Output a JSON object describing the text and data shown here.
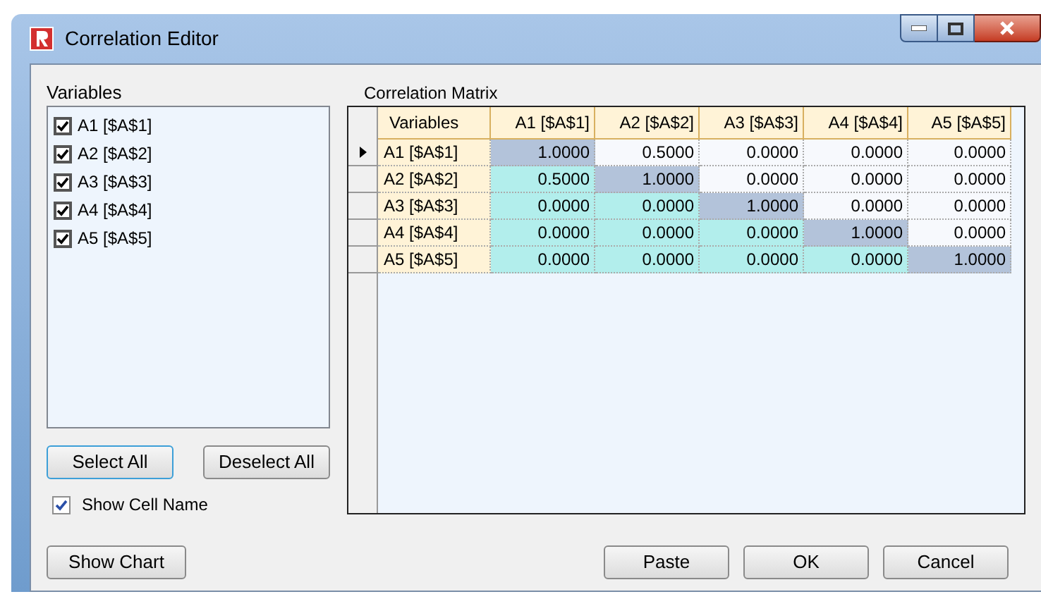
{
  "window": {
    "title": "Correlation Editor"
  },
  "variables": {
    "label": "Variables",
    "items": [
      {
        "label": "A1 [$A$1]",
        "checked": true
      },
      {
        "label": "A2 [$A$2]",
        "checked": true
      },
      {
        "label": "A3 [$A$3]",
        "checked": true
      },
      {
        "label": "A4 [$A$4]",
        "checked": true
      },
      {
        "label": "A5 [$A$5]",
        "checked": true
      }
    ]
  },
  "select_all": "Select All",
  "deselect_all": "Deselect All",
  "show_cell_name": {
    "label": "Show Cell Name",
    "checked": true
  },
  "matrix": {
    "label": "Correlation Matrix",
    "columns": [
      "Variables",
      "A1 [$A$1]",
      "A2 [$A$2]",
      "A3 [$A$3]",
      "A4 [$A$4]",
      "A5 [$A$5]"
    ],
    "rows": [
      {
        "current": true,
        "cells": [
          {
            "value": "A1 [$A$1]",
            "kind": "name"
          },
          {
            "value": "1.0000",
            "kind": "diagonal"
          },
          {
            "value": "0.5000",
            "kind": "upper"
          },
          {
            "value": "0.0000",
            "kind": "upper"
          },
          {
            "value": "0.0000",
            "kind": "upper"
          },
          {
            "value": "0.0000",
            "kind": "upper"
          }
        ]
      },
      {
        "current": false,
        "cells": [
          {
            "value": "A2 [$A$2]",
            "kind": "name"
          },
          {
            "value": "0.5000",
            "kind": "lower"
          },
          {
            "value": "1.0000",
            "kind": "diagonal"
          },
          {
            "value": "0.0000",
            "kind": "upper"
          },
          {
            "value": "0.0000",
            "kind": "upper"
          },
          {
            "value": "0.0000",
            "kind": "upper"
          }
        ]
      },
      {
        "current": false,
        "cells": [
          {
            "value": "A3 [$A$3]",
            "kind": "name"
          },
          {
            "value": "0.0000",
            "kind": "lower"
          },
          {
            "value": "0.0000",
            "kind": "lower"
          },
          {
            "value": "1.0000",
            "kind": "diagonal"
          },
          {
            "value": "0.0000",
            "kind": "upper"
          },
          {
            "value": "0.0000",
            "kind": "upper"
          }
        ]
      },
      {
        "current": false,
        "cells": [
          {
            "value": "A4 [$A$4]",
            "kind": "name"
          },
          {
            "value": "0.0000",
            "kind": "lower"
          },
          {
            "value": "0.0000",
            "kind": "lower"
          },
          {
            "value": "0.0000",
            "kind": "lower"
          },
          {
            "value": "1.0000",
            "kind": "diagonal"
          },
          {
            "value": "0.0000",
            "kind": "upper"
          }
        ]
      },
      {
        "current": false,
        "cells": [
          {
            "value": "A5 [$A$5]",
            "kind": "name"
          },
          {
            "value": "0.0000",
            "kind": "lower"
          },
          {
            "value": "0.0000",
            "kind": "lower"
          },
          {
            "value": "0.0000",
            "kind": "lower"
          },
          {
            "value": "0.0000",
            "kind": "lower"
          },
          {
            "value": "1.0000",
            "kind": "diagonal"
          }
        ]
      }
    ]
  },
  "buttons": {
    "show_chart": "Show Chart",
    "paste": "Paste",
    "ok": "OK",
    "cancel": "Cancel"
  }
}
